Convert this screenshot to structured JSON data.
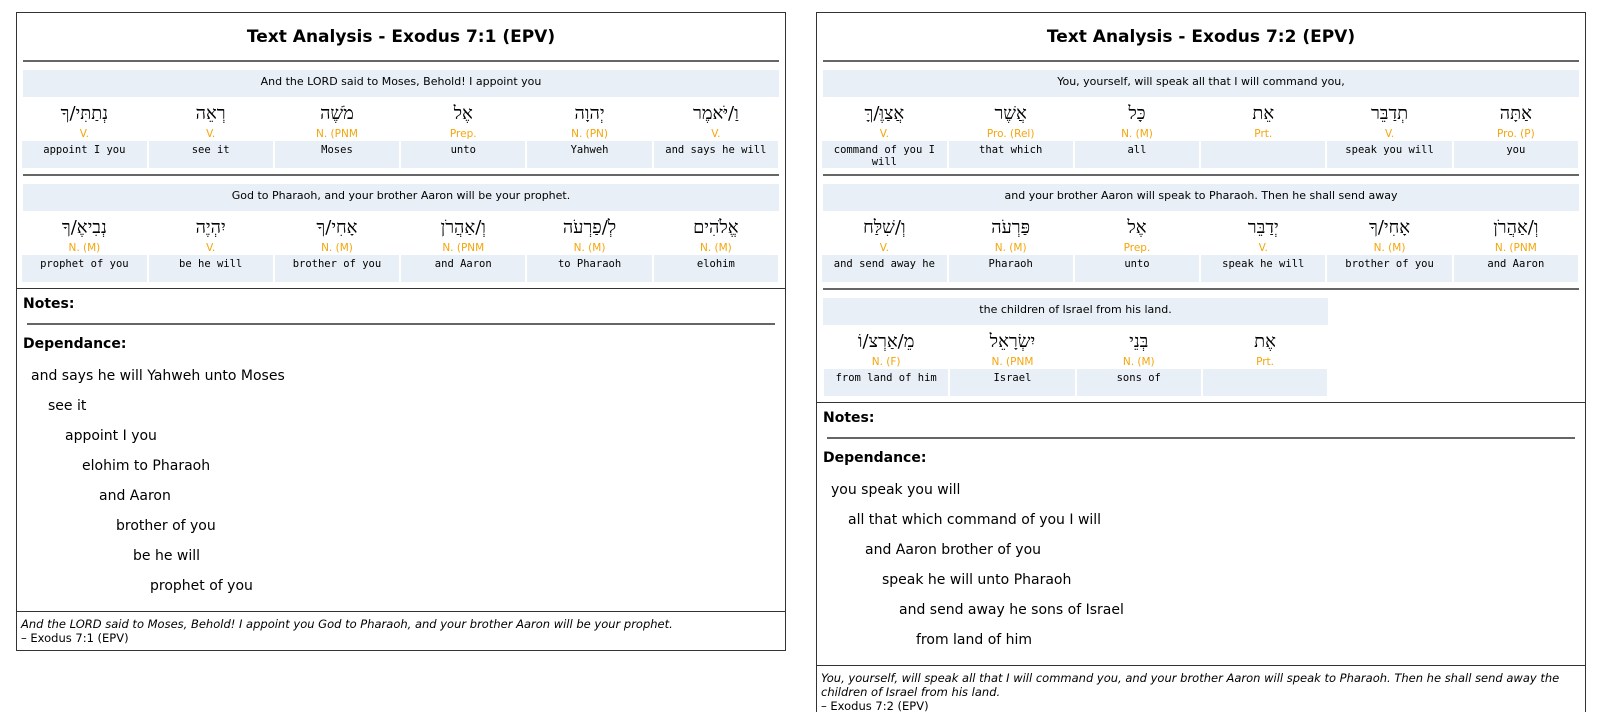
{
  "panels": [
    {
      "title": "Text Analysis - Exodus 7:1 (EPV)",
      "segments": [
        {
          "english": "And the LORD said to Moses, Behold! I appoint you",
          "words": [
            {
              "hebrew": "וַ/יֹּאמֶר",
              "pos": "V.",
              "gloss": "and says he will"
            },
            {
              "hebrew": "יְהוָה",
              "pos": "N. (PN)",
              "gloss": "Yahweh"
            },
            {
              "hebrew": "אֶל",
              "pos": "Prep.",
              "gloss": "unto"
            },
            {
              "hebrew": "מֹשֶׁה",
              "pos": "N. (PNM",
              "gloss": "Moses"
            },
            {
              "hebrew": "רְאֵה",
              "pos": "V.",
              "gloss": "see it"
            },
            {
              "hebrew": "נְתַתִּי/ךָ",
              "pos": "V.",
              "gloss": "appoint I you"
            }
          ]
        },
        {
          "english": "God to Pharaoh, and your brother Aaron will be your prophet.",
          "words": [
            {
              "hebrew": "אֱלֹהִים",
              "pos": "N. (M)",
              "gloss": "elohim"
            },
            {
              "hebrew": "לְ/פַרְעֹה",
              "pos": "N. (M)",
              "gloss": "to Pharaoh"
            },
            {
              "hebrew": "וְ/אַהֲרֹן",
              "pos": "N. (PNM",
              "gloss": "and Aaron"
            },
            {
              "hebrew": "אָחִי/ךָ",
              "pos": "N. (M)",
              "gloss": "brother of you"
            },
            {
              "hebrew": "יִהְיֶה",
              "pos": "V.",
              "gloss": "be he will"
            },
            {
              "hebrew": "נְבִיאֶ/ךָ",
              "pos": "N. (M)",
              "gloss": "prophet of you"
            }
          ]
        }
      ],
      "notes_label": "Notes:",
      "dependance_label": "Dependance:",
      "dependance": [
        "and says he will Yahweh unto Moses",
        "see it",
        "appoint I you",
        "elohim to Pharaoh",
        "and Aaron",
        "brother of you",
        "be he will",
        "prophet of you"
      ],
      "footer_quote": "And the LORD said to Moses, Behold! I appoint you God to Pharaoh, and your brother Aaron will be your prophet.",
      "footer_ref": "– Exodus 7:1 (EPV)"
    },
    {
      "title": "Text Analysis - Exodus 7:2 (EPV)",
      "segments": [
        {
          "english": "You, yourself, will speak all that I will command you,",
          "words": [
            {
              "hebrew": "אַתָּה",
              "pos": "Pro. (P)",
              "gloss": "you"
            },
            {
              "hebrew": "תְדַבֵּר",
              "pos": "V.",
              "gloss": "speak you will"
            },
            {
              "hebrew": "אֵת",
              "pos": "Prt.",
              "gloss": ""
            },
            {
              "hebrew": "כָּל",
              "pos": "N. (M)",
              "gloss": "all"
            },
            {
              "hebrew": "אֲשֶׁר",
              "pos": "Pro. (Rel)",
              "gloss": "that which"
            },
            {
              "hebrew": "אֲצַוֶּ/ךָּ",
              "pos": "V.",
              "gloss": "command of you I will"
            }
          ]
        },
        {
          "english": "and your brother Aaron will speak to Pharaoh. Then he shall send away",
          "words": [
            {
              "hebrew": "וְ/אַהֲרֹן",
              "pos": "N. (PNM",
              "gloss": "and Aaron"
            },
            {
              "hebrew": "אָחִי/ךָ",
              "pos": "N. (M)",
              "gloss": "brother of you"
            },
            {
              "hebrew": "יְדַבֵּר",
              "pos": "V.",
              "gloss": "speak he will"
            },
            {
              "hebrew": "אֶל",
              "pos": "Prep.",
              "gloss": "unto"
            },
            {
              "hebrew": "פַּרְעֹה",
              "pos": "N. (M)",
              "gloss": "Pharaoh"
            },
            {
              "hebrew": "וְ/שִׁלַּח",
              "pos": "V.",
              "gloss": "and send away he"
            }
          ]
        },
        {
          "english": "the children of Israel from his land.",
          "words": [
            {
              "hebrew": "אֶת",
              "pos": "Prt.",
              "gloss": ""
            },
            {
              "hebrew": "בְּנֵי",
              "pos": "N. (M)",
              "gloss": "sons of"
            },
            {
              "hebrew": "יִשְׂרָאֵל",
              "pos": "N. (PNM",
              "gloss": "Israel"
            },
            {
              "hebrew": "מֵ/אַרְצ/וֹ",
              "pos": "N. (F)",
              "gloss": "from land of him"
            }
          ]
        }
      ],
      "notes_label": "Notes:",
      "dependance_label": "Dependance:",
      "dependance": [
        "you speak you will",
        "all that which command of you I will",
        "and Aaron brother of you",
        "speak he will unto Pharaoh",
        "and send away he sons of Israel",
        "from land of him"
      ],
      "footer_quote": "You, yourself, will speak all that I will command you, and your brother Aaron will speak to Pharaoh. Then he shall send away the children of Israel from his land.",
      "footer_ref": "– Exodus 7:2 (EPV)"
    }
  ],
  "colors": {
    "pos_label": "#f5a50b",
    "row_background": "#e9eff6",
    "border": "#333333"
  }
}
